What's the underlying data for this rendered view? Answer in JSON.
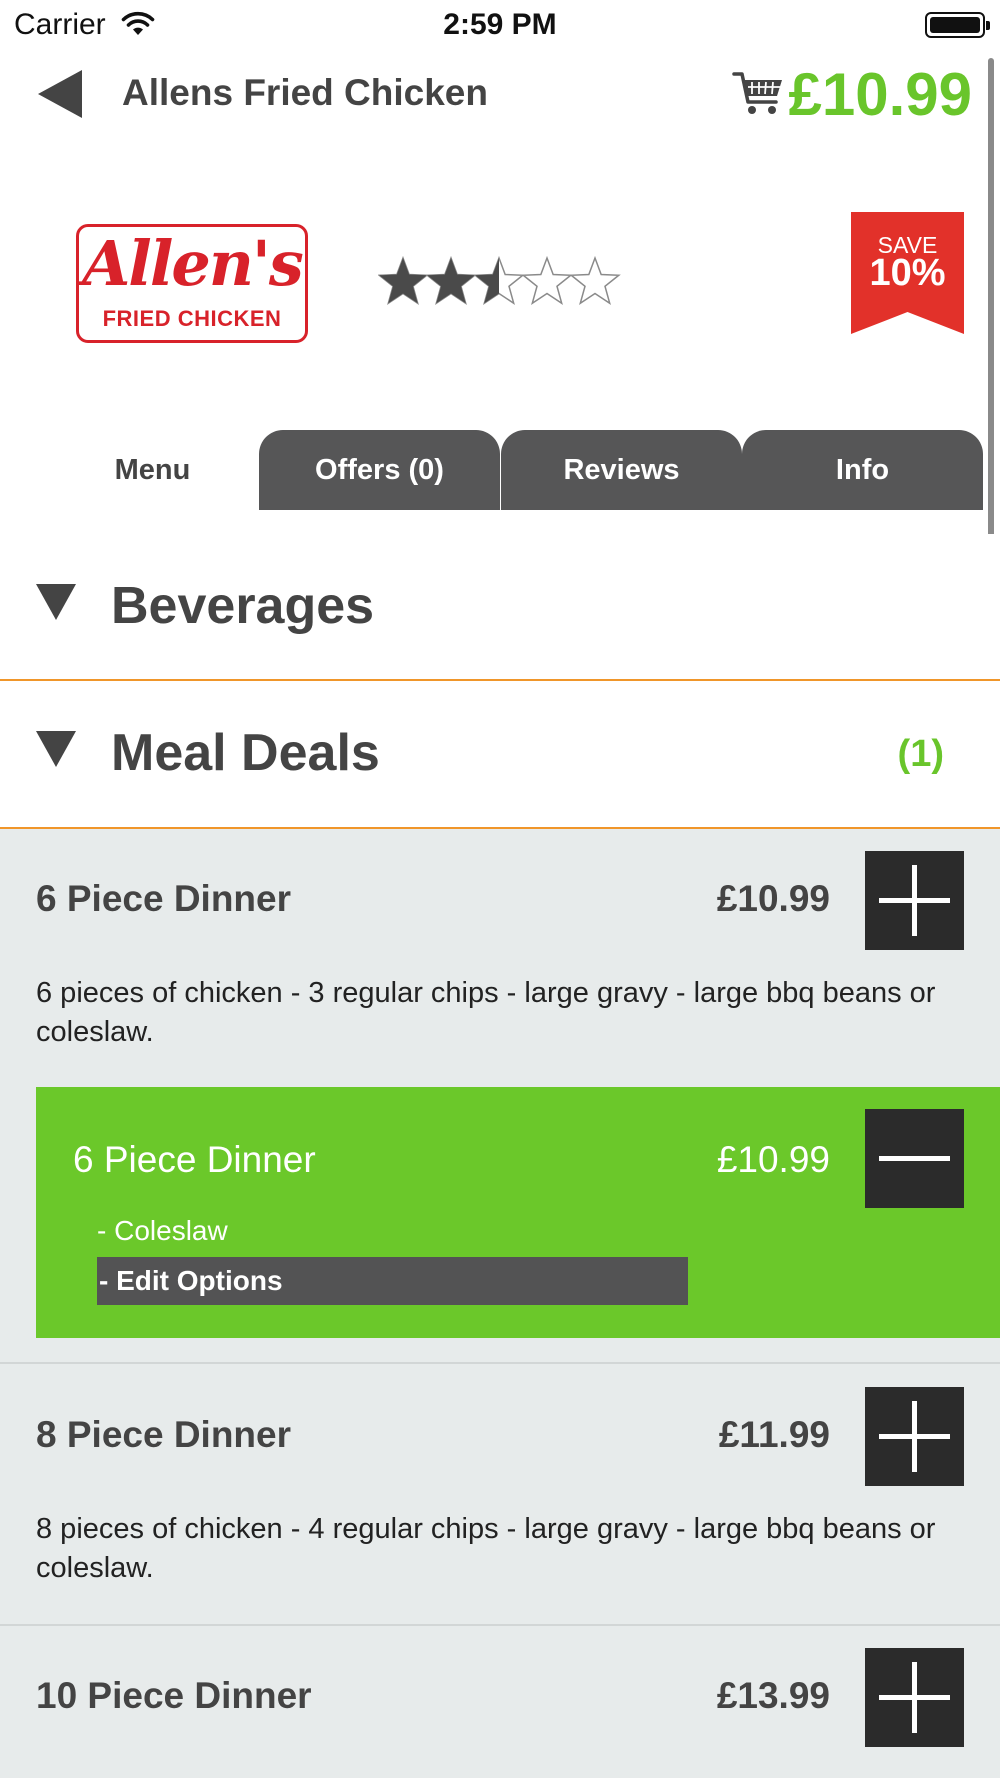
{
  "status_bar": {
    "carrier": "Carrier",
    "time": "2:59 PM",
    "wifi_icon": "wifi-icon",
    "battery_icon": "battery-icon"
  },
  "header": {
    "back_icon": "back-arrow-icon",
    "title": "Allens Fried Chicken",
    "cart_icon": "cart-icon",
    "cart_total": "£10.99"
  },
  "store": {
    "logo_script": "Allen's",
    "logo_sub": "FRIED CHICKEN",
    "rating_stars": 2.5,
    "rating_max": 5,
    "save_label": "SAVE",
    "save_value": "10%"
  },
  "tabs": [
    {
      "label": "Menu",
      "active": true
    },
    {
      "label": "Offers (0)",
      "active": false
    },
    {
      "label": "Reviews",
      "active": false
    },
    {
      "label": "Info",
      "active": false
    }
  ],
  "categories": [
    {
      "title": "Beverages",
      "count": ""
    },
    {
      "title": "Meal Deals",
      "count": "(1)"
    }
  ],
  "items": [
    {
      "name": "6 Piece Dinner",
      "price": "£10.99",
      "description": "6 pieces of chicken - 3 regular chips - large gravy - large bbq beans or coleslaw."
    },
    {
      "name": "8 Piece Dinner",
      "price": "£11.99",
      "description": "8 pieces of chicken - 4 regular chips - large gravy - large bbq beans or coleslaw."
    },
    {
      "name": "10 Piece Dinner",
      "price": "£13.99",
      "description": ""
    }
  ],
  "cart_line": {
    "name": "6 Piece Dinner",
    "price": "£10.99",
    "option": "- Coleslaw",
    "edit_label": "- Edit Options"
  },
  "colors": {
    "accent_green": "#69c52b",
    "divider_orange": "#f0962a",
    "save_red": "#e2312a",
    "tab_dark": "#565657"
  }
}
